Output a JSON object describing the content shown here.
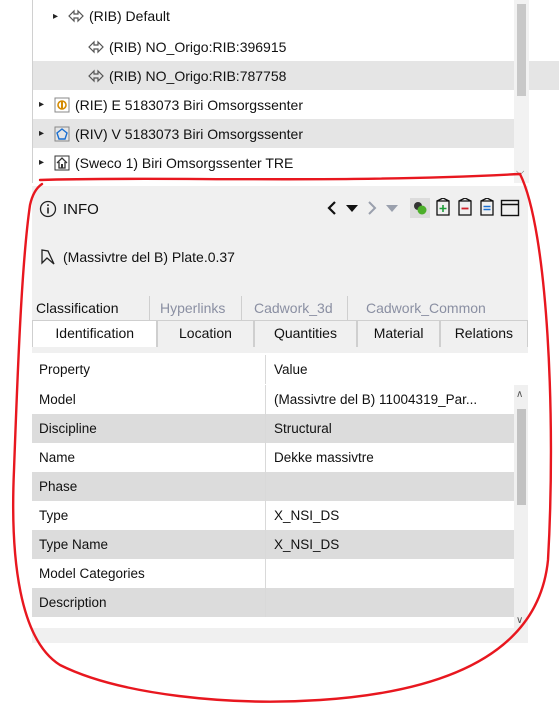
{
  "tree": {
    "items": [
      {
        "label": "(RIB) Default",
        "expander": "▸",
        "icon": "link-icon"
      },
      {
        "label": "(RIB) NO_Origo:RIB:396915",
        "expander": "",
        "icon": "link-icon"
      },
      {
        "label": "(RIB) NO_Origo:RIB:787758",
        "expander": "",
        "icon": "link-icon"
      },
      {
        "label": "(RIE) E 5183073 Biri Omsorgssenter",
        "expander": "▸",
        "icon": "model-icon"
      },
      {
        "label": "(RIV) V 5183073 Biri Omsorgssenter",
        "expander": "▸",
        "icon": "pentagon-icon"
      },
      {
        "label": "(Sweco 1) Biri Omsorgssenter TRE",
        "expander": "▸",
        "icon": "house-icon"
      }
    ]
  },
  "info": {
    "title": "INFO",
    "selection_label": "(Massivtre del B) Plate.0.37",
    "nav_back": "‹",
    "nav_forward": "›"
  },
  "tabs_row1": [
    "Classification",
    "Hyperlinks",
    "Cadwork_3d",
    "Cadwork_Common"
  ],
  "tabs_row2": [
    "Identification",
    "Location",
    "Quantities",
    "Material",
    "Relations"
  ],
  "grid": {
    "headers": {
      "property": "Property",
      "value": "Value"
    },
    "rows": [
      {
        "property": "Model",
        "value": "(Massivtre del B) 11004319_Par..."
      },
      {
        "property": "Discipline",
        "value": "Structural"
      },
      {
        "property": "Name",
        "value": "Dekke massivtre"
      },
      {
        "property": "Phase",
        "value": ""
      },
      {
        "property": "Type",
        "value": "X_NSI_DS"
      },
      {
        "property": "Type Name",
        "value": "X_NSI_DS"
      },
      {
        "property": "Model Categories",
        "value": ""
      },
      {
        "property": "Description",
        "value": ""
      }
    ]
  },
  "colors": {
    "annotation": "#e8171f",
    "accent": "#1a6fd1",
    "active_tab": "#ffffff"
  }
}
